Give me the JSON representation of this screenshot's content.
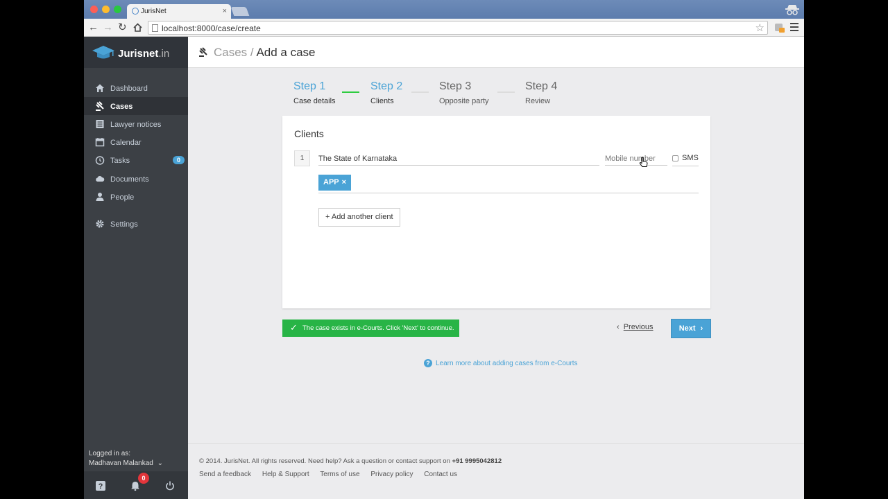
{
  "browser": {
    "tab_title": "JurisNet",
    "tab_close": "×",
    "url": "localhost:8000/case/create"
  },
  "sidebar": {
    "brand": "Jurisnet",
    "brand_suffix": ".in",
    "items": [
      {
        "label": "Dashboard",
        "icon": "home-icon"
      },
      {
        "label": "Cases",
        "icon": "gavel-icon",
        "active": true
      },
      {
        "label": "Lawyer notices",
        "icon": "notice-icon"
      },
      {
        "label": "Calendar",
        "icon": "calendar-icon"
      },
      {
        "label": "Tasks",
        "icon": "clock-icon",
        "badge": "0"
      },
      {
        "label": "Documents",
        "icon": "cloud-icon"
      },
      {
        "label": "People",
        "icon": "person-icon"
      },
      {
        "label": "Settings",
        "icon": "gear-icon"
      }
    ],
    "logged_in_label": "Logged in as:",
    "user_name": "Madhavan Malankad",
    "notifications_count": "0"
  },
  "header": {
    "breadcrumb_parent": "Cases",
    "separator": "/",
    "title": "Add a case"
  },
  "steps": [
    {
      "title": "Step 1",
      "subtitle": "Case details"
    },
    {
      "title": "Step 2",
      "subtitle": "Clients"
    },
    {
      "title": "Step 3",
      "subtitle": "Opposite party"
    },
    {
      "title": "Step 4",
      "subtitle": "Review"
    }
  ],
  "clients": {
    "heading": "Clients",
    "row_number": "1",
    "client_name": "The State of Karnataka",
    "mobile_placeholder": "Mobile number",
    "sms_label": "SMS",
    "tag": "APP",
    "tag_remove": "×",
    "add_button": "+ Add another client"
  },
  "status": {
    "message": "The case exists in e-Courts. Click 'Next' to continue."
  },
  "nav": {
    "previous": "Previous",
    "next": "Next"
  },
  "help_link": "Learn more about adding cases from e-Courts",
  "footer": {
    "copyright": "© 2014. JurisNet. All rights reserved. Need help? Ask a question or contact support on",
    "phone": "+91 9995042812",
    "links": [
      "Send a feedback",
      "Help & Support",
      "Terms of use",
      "Privacy policy",
      "Contact us"
    ]
  },
  "colors": {
    "accent": "#4aa3d6",
    "success": "#28b446",
    "sidebar": "#3c4045",
    "danger": "#e3353b"
  }
}
